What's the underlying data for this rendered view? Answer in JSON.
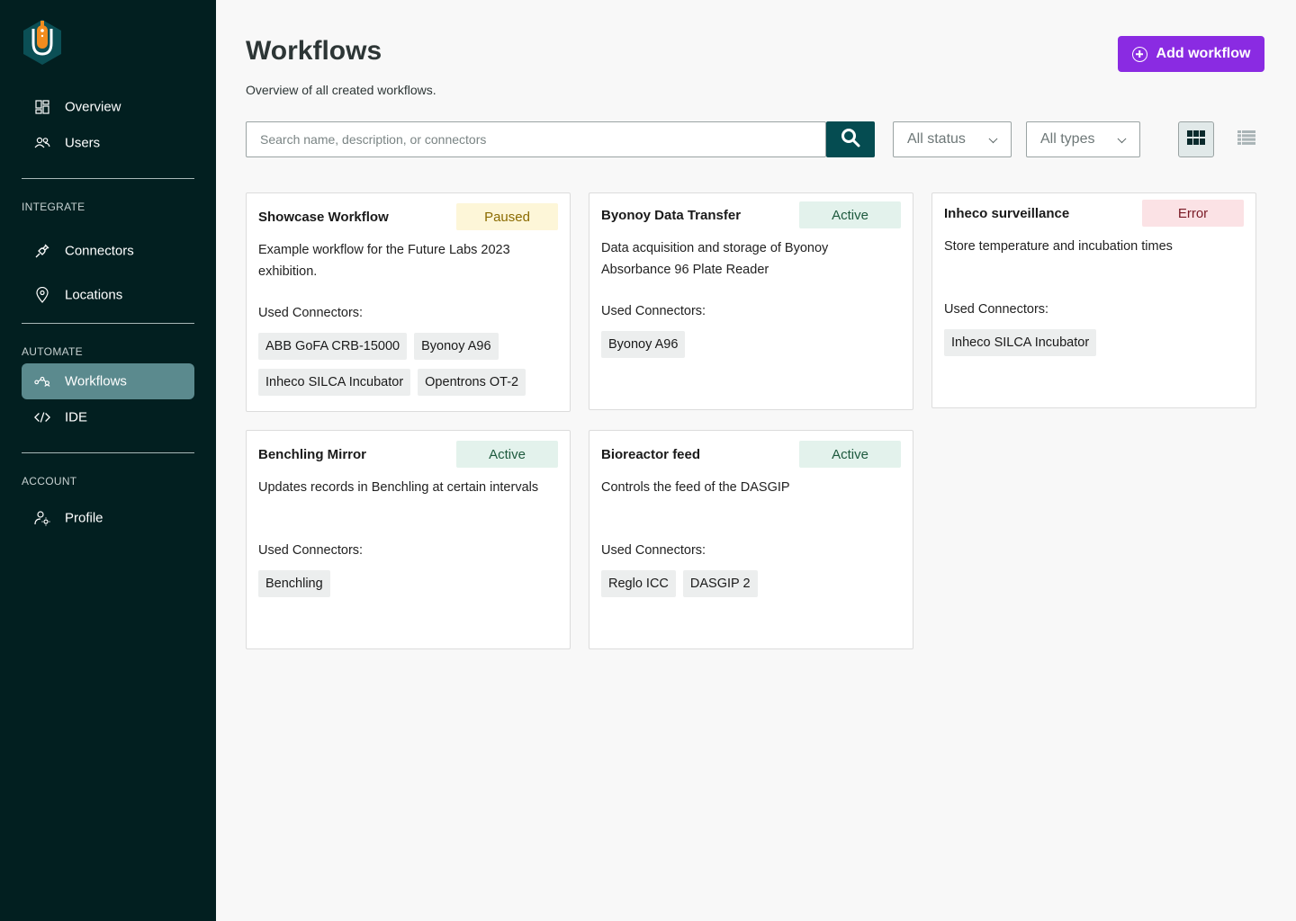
{
  "sidebar": {
    "items_top": [
      {
        "label": "Overview",
        "icon": "dashboard-icon"
      },
      {
        "label": "Users",
        "icon": "users-icon"
      }
    ],
    "integrate_label": "INTEGRATE",
    "items_integrate": [
      {
        "label": "Connectors",
        "icon": "plug-icon"
      },
      {
        "label": "Locations",
        "icon": "location-pin-icon"
      }
    ],
    "automate_label": "AUTOMATE",
    "items_automate": [
      {
        "label": "Workflows",
        "icon": "workflow-icon",
        "active": true
      },
      {
        "label": "IDE",
        "icon": "code-icon"
      }
    ],
    "account_label": "ACCOUNT",
    "items_account": [
      {
        "label": "Profile",
        "icon": "profile-settings-icon"
      }
    ]
  },
  "header": {
    "title": "Workflows",
    "subtitle": "Overview of all created workflows.",
    "add_button": "Add workflow"
  },
  "filters": {
    "search_placeholder": "Search name, description, or connectors",
    "status_select": "All status",
    "types_select": "All types"
  },
  "labels": {
    "used_connectors": "Used Connectors:"
  },
  "workflows": [
    {
      "title": "Showcase Workflow",
      "status": "Paused",
      "description": "Example workflow for the Future Labs 2023 exhibition.",
      "connectors": [
        "ABB GoFA CRB-15000",
        "Byonoy A96",
        "Inheco SILCA Incubator",
        "Opentrons OT-2"
      ]
    },
    {
      "title": "Byonoy Data Transfer",
      "status": "Active",
      "description": "Data acquisition and storage of Byonoy Absorbance 96 Plate Reader",
      "connectors": [
        "Byonoy A96"
      ]
    },
    {
      "title": "Inheco surveillance",
      "status": "Error",
      "description": "Store temperature and incubation times",
      "connectors": [
        "Inheco SILCA Incubator"
      ]
    },
    {
      "title": "Benchling Mirror",
      "status": "Active",
      "description": "Updates records in Benchling at certain intervals",
      "connectors": [
        "Benchling"
      ]
    },
    {
      "title": "Bioreactor feed",
      "status": "Active",
      "description": "Controls the feed of the DASGIP",
      "connectors": [
        "Reglo ICC",
        "DASGIP 2"
      ]
    }
  ],
  "colors": {
    "sidebar_bg": "#021f20",
    "sidebar_active": "#5b8a8e",
    "accent_purple": "#8a2be2",
    "search_button": "#054c51",
    "status_paused": "#fdf6d8",
    "status_active": "#e3f2ec",
    "status_error": "#fbe2e5"
  }
}
